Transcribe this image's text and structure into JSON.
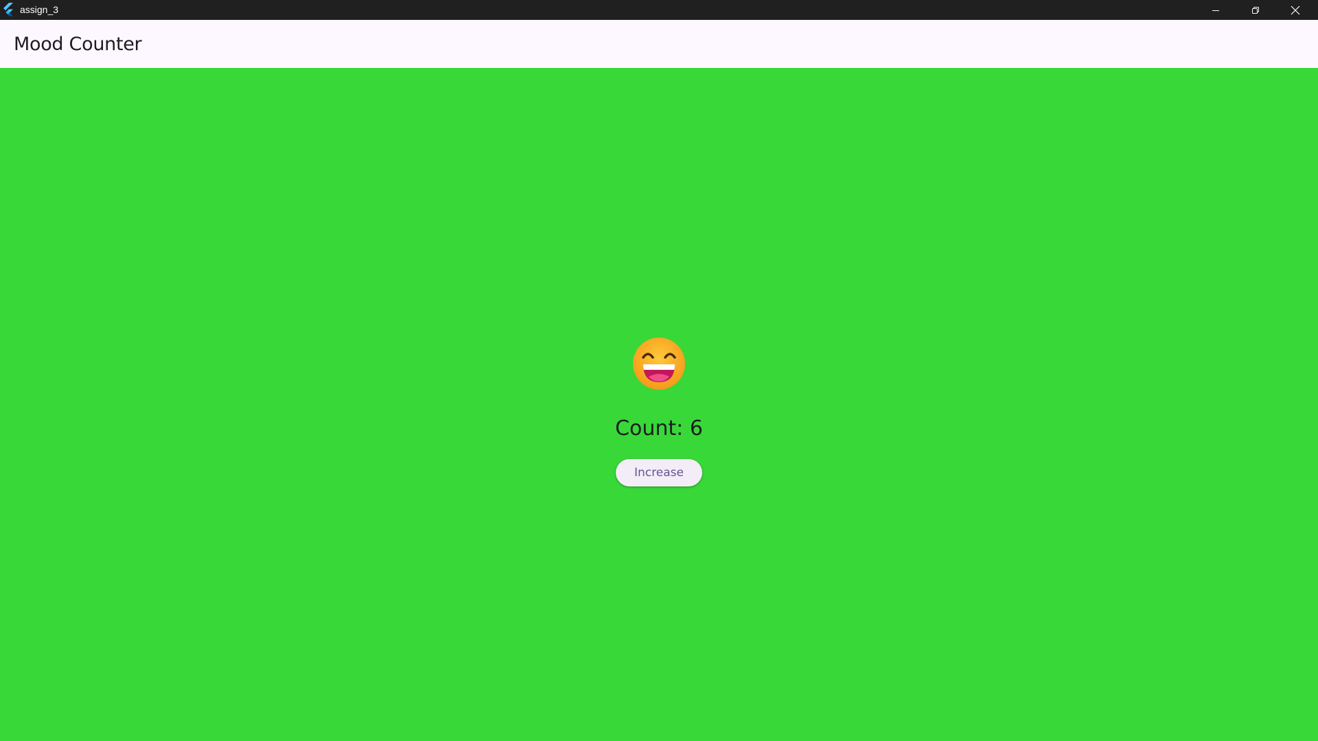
{
  "window": {
    "title": "assign_3",
    "icon": "flutter-logo-icon",
    "controls": {
      "minimize_icon": "minimize-icon",
      "maximize_icon": "restore-icon",
      "close_icon": "close-icon"
    }
  },
  "appbar": {
    "title": "Mood Counter"
  },
  "main": {
    "background_color": "#38d838",
    "mood_icon": "grinning-face-smiling-eyes-icon",
    "count_text": "Count: 6",
    "increase_label": "Increase"
  },
  "colors": {
    "titlebar": "#202020",
    "appbar": "#fdf7ff",
    "button_bg": "#f3edf7",
    "button_text": "#65558f",
    "emoji_face": "#f8a921"
  }
}
